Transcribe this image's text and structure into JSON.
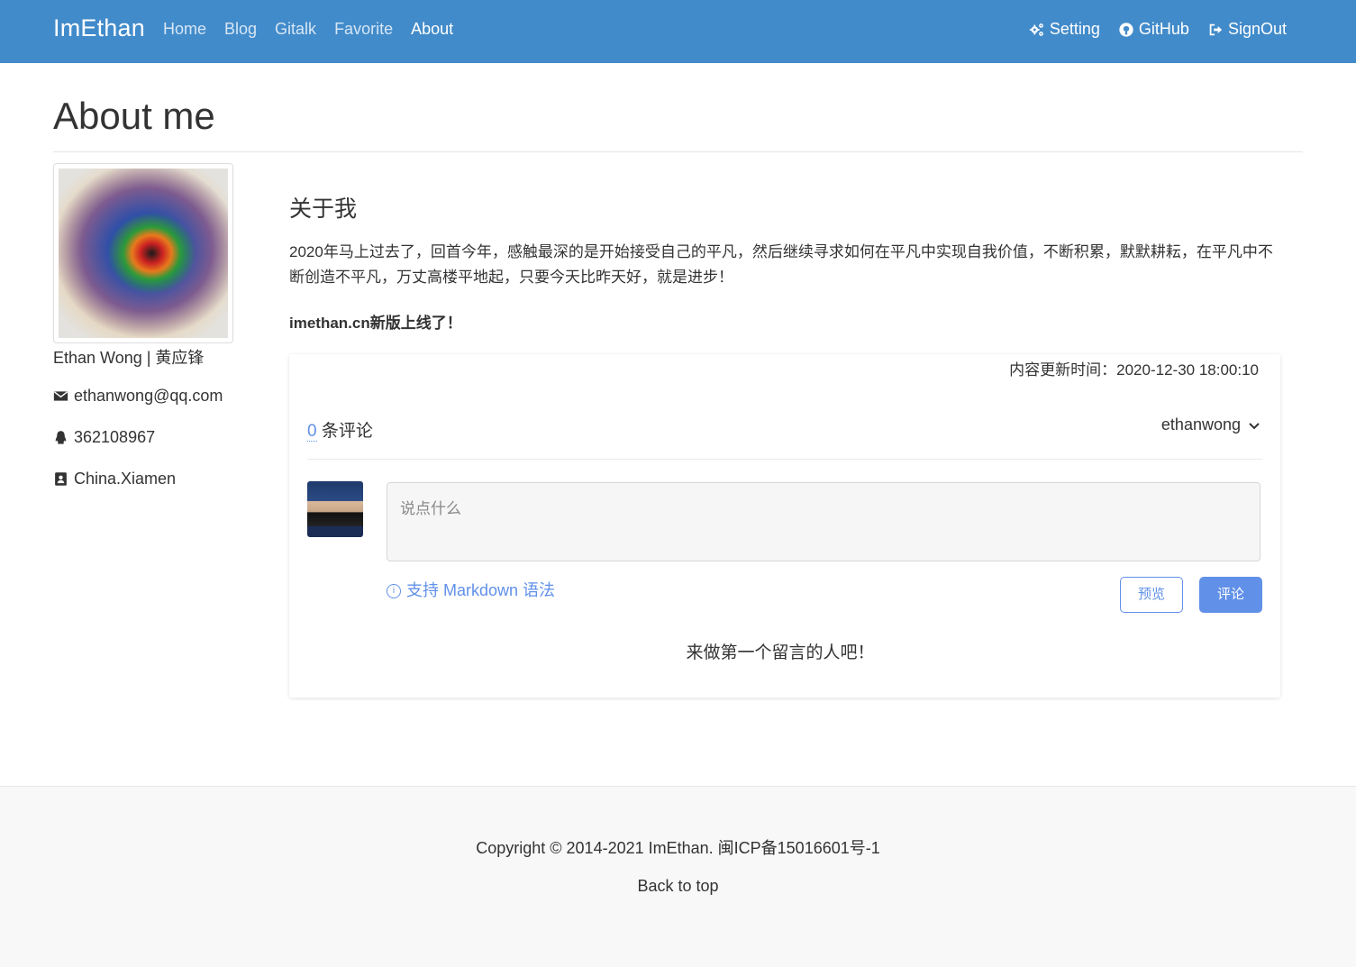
{
  "nav": {
    "brand": "ImEthan",
    "links": [
      "Home",
      "Blog",
      "Gitalk",
      "Favorite",
      "About"
    ],
    "active": "About",
    "right": {
      "setting": "Setting",
      "github": "GitHub",
      "signout": "SignOut"
    }
  },
  "page": {
    "title": "About me"
  },
  "profile": {
    "name": "Ethan Wong | 黄应锋",
    "email": "ethanwong@qq.com",
    "qq": "362108967",
    "location": "China.Xiamen"
  },
  "about": {
    "heading": "关于我",
    "paragraph": "2020年马上过去了，回首今年，感触最深的是开始接受自己的平凡，然后继续寻求如何在平凡中实现自我价值，不断积累，默默耕耘，在平凡中不断创造不平凡，万丈高楼平地起，只要今天比昨天好，就是进步！",
    "notice": "imethan.cn新版上线了！"
  },
  "comments": {
    "update_time": "内容更新时间：2020-12-30 18:00:10",
    "count": "0",
    "count_label": " 条评论",
    "username": "ethanwong",
    "placeholder": "说点什么",
    "markdown_tip": "支持 Markdown 语法",
    "preview_label": "预览",
    "submit_label": "评论",
    "empty_message": "来做第一个留言的人吧！"
  },
  "footer": {
    "copyright": "Copyright © 2014-2021 ImEthan. 闽ICP备15016601号-1",
    "back_to_top": "Back to top"
  },
  "colors": {
    "navbar": "#428bca",
    "accent": "#6190e8",
    "footer_bg": "#f8f8f8"
  }
}
